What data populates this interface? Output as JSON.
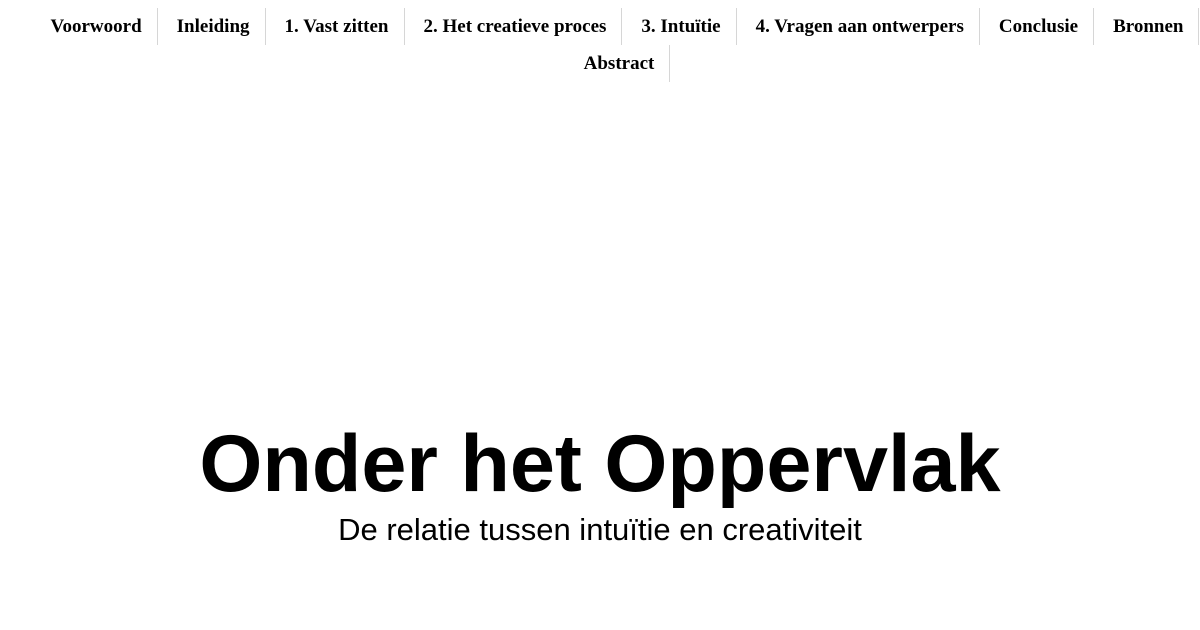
{
  "nav": {
    "items": [
      {
        "label": "Voorwoord"
      },
      {
        "label": "Inleiding"
      },
      {
        "label": "1. Vast zitten"
      },
      {
        "label": "2. Het creatieve proces"
      },
      {
        "label": "3. Intuïtie"
      },
      {
        "label": "4. Vragen aan ontwerpers"
      },
      {
        "label": "Conclusie"
      },
      {
        "label": "Bronnen"
      },
      {
        "label": "Abstract"
      }
    ]
  },
  "hero": {
    "title": "Onder het Oppervlak",
    "subtitle": "De relatie tussen intuïtie en creativiteit"
  },
  "colors": {
    "background": "#ffffff",
    "text": "#000000",
    "divider": "#d6d6d6"
  }
}
